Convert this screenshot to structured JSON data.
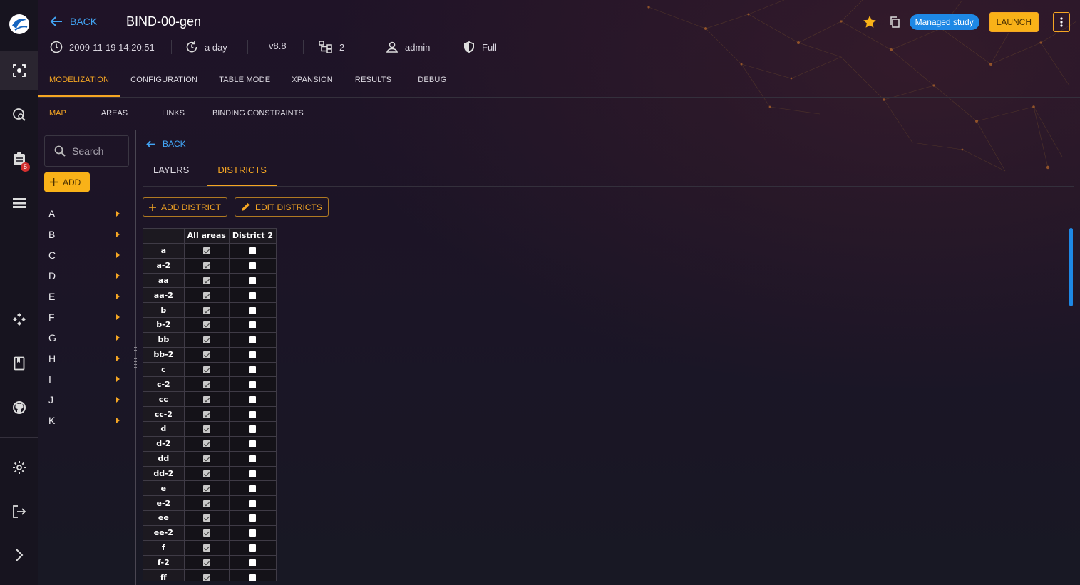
{
  "header": {
    "back_label": "BACK",
    "study_name": "BIND-00-gen",
    "date": "2009-11-19 14:20:51",
    "modified": "a day",
    "version": "v8.8",
    "variants": "2",
    "owner": "admin",
    "permission": "Full",
    "managed_badge": "Managed study",
    "launch_label": "LAUNCH"
  },
  "rail": {
    "notifications_count": "5",
    "icons": [
      "study-icon",
      "search-study-icon",
      "tasks-icon",
      "list-icon",
      "api-icon",
      "docs-icon",
      "github-icon",
      "settings-icon",
      "logout-icon",
      "expand-icon"
    ]
  },
  "tabs": [
    "MODELIZATION",
    "CONFIGURATION",
    "TABLE MODE",
    "XPANSION",
    "RESULTS",
    "DEBUG"
  ],
  "subtabs": [
    "MAP",
    "AREAS",
    "LINKS",
    "BINDING CONSTRAINTS"
  ],
  "left_panel": {
    "search_placeholder": "Search",
    "add_label": "ADD",
    "letters": [
      "A",
      "B",
      "C",
      "D",
      "E",
      "F",
      "G",
      "H",
      "I",
      "J",
      "K"
    ]
  },
  "districts_view": {
    "back_label": "BACK",
    "layer_tabs": [
      "LAYERS",
      "DISTRICTS"
    ],
    "add_district_label": "ADD DISTRICT",
    "edit_districts_label": "EDIT DISTRICTS",
    "columns": [
      "All areas",
      "District 2"
    ],
    "rows": [
      {
        "area": "a",
        "all": true,
        "d2": false
      },
      {
        "area": "a-2",
        "all": true,
        "d2": false
      },
      {
        "area": "aa",
        "all": true,
        "d2": false
      },
      {
        "area": "aa-2",
        "all": true,
        "d2": false
      },
      {
        "area": "b",
        "all": true,
        "d2": false
      },
      {
        "area": "b-2",
        "all": true,
        "d2": false
      },
      {
        "area": "bb",
        "all": true,
        "d2": false
      },
      {
        "area": "bb-2",
        "all": true,
        "d2": false
      },
      {
        "area": "c",
        "all": true,
        "d2": false
      },
      {
        "area": "c-2",
        "all": true,
        "d2": false
      },
      {
        "area": "cc",
        "all": true,
        "d2": false
      },
      {
        "area": "cc-2",
        "all": true,
        "d2": false
      },
      {
        "area": "d",
        "all": true,
        "d2": false
      },
      {
        "area": "d-2",
        "all": true,
        "d2": false
      },
      {
        "area": "dd",
        "all": true,
        "d2": false
      },
      {
        "area": "dd-2",
        "all": true,
        "d2": false
      },
      {
        "area": "e",
        "all": true,
        "d2": false
      },
      {
        "area": "e-2",
        "all": true,
        "d2": false
      },
      {
        "area": "ee",
        "all": true,
        "d2": false
      },
      {
        "area": "ee-2",
        "all": true,
        "d2": false
      },
      {
        "area": "f",
        "all": true,
        "d2": false
      },
      {
        "area": "f-2",
        "all": true,
        "d2": false
      },
      {
        "area": "ff",
        "all": true,
        "d2": false
      }
    ]
  },
  "colors": {
    "accent": "#f5a623",
    "link": "#42a5f5",
    "badge": "#1e88e5"
  }
}
